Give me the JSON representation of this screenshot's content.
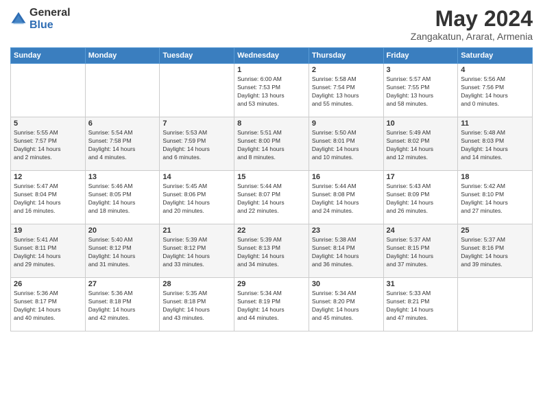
{
  "logo": {
    "general": "General",
    "blue": "Blue"
  },
  "header": {
    "month_year": "May 2024",
    "location": "Zangakatun, Ararat, Armenia"
  },
  "days_of_week": [
    "Sunday",
    "Monday",
    "Tuesday",
    "Wednesday",
    "Thursday",
    "Friday",
    "Saturday"
  ],
  "weeks": [
    [
      {
        "day": "",
        "info": ""
      },
      {
        "day": "",
        "info": ""
      },
      {
        "day": "",
        "info": ""
      },
      {
        "day": "1",
        "info": "Sunrise: 6:00 AM\nSunset: 7:53 PM\nDaylight: 13 hours\nand 53 minutes."
      },
      {
        "day": "2",
        "info": "Sunrise: 5:58 AM\nSunset: 7:54 PM\nDaylight: 13 hours\nand 55 minutes."
      },
      {
        "day": "3",
        "info": "Sunrise: 5:57 AM\nSunset: 7:55 PM\nDaylight: 13 hours\nand 58 minutes."
      },
      {
        "day": "4",
        "info": "Sunrise: 5:56 AM\nSunset: 7:56 PM\nDaylight: 14 hours\nand 0 minutes."
      }
    ],
    [
      {
        "day": "5",
        "info": "Sunrise: 5:55 AM\nSunset: 7:57 PM\nDaylight: 14 hours\nand 2 minutes."
      },
      {
        "day": "6",
        "info": "Sunrise: 5:54 AM\nSunset: 7:58 PM\nDaylight: 14 hours\nand 4 minutes."
      },
      {
        "day": "7",
        "info": "Sunrise: 5:53 AM\nSunset: 7:59 PM\nDaylight: 14 hours\nand 6 minutes."
      },
      {
        "day": "8",
        "info": "Sunrise: 5:51 AM\nSunset: 8:00 PM\nDaylight: 14 hours\nand 8 minutes."
      },
      {
        "day": "9",
        "info": "Sunrise: 5:50 AM\nSunset: 8:01 PM\nDaylight: 14 hours\nand 10 minutes."
      },
      {
        "day": "10",
        "info": "Sunrise: 5:49 AM\nSunset: 8:02 PM\nDaylight: 14 hours\nand 12 minutes."
      },
      {
        "day": "11",
        "info": "Sunrise: 5:48 AM\nSunset: 8:03 PM\nDaylight: 14 hours\nand 14 minutes."
      }
    ],
    [
      {
        "day": "12",
        "info": "Sunrise: 5:47 AM\nSunset: 8:04 PM\nDaylight: 14 hours\nand 16 minutes."
      },
      {
        "day": "13",
        "info": "Sunrise: 5:46 AM\nSunset: 8:05 PM\nDaylight: 14 hours\nand 18 minutes."
      },
      {
        "day": "14",
        "info": "Sunrise: 5:45 AM\nSunset: 8:06 PM\nDaylight: 14 hours\nand 20 minutes."
      },
      {
        "day": "15",
        "info": "Sunrise: 5:44 AM\nSunset: 8:07 PM\nDaylight: 14 hours\nand 22 minutes."
      },
      {
        "day": "16",
        "info": "Sunrise: 5:44 AM\nSunset: 8:08 PM\nDaylight: 14 hours\nand 24 minutes."
      },
      {
        "day": "17",
        "info": "Sunrise: 5:43 AM\nSunset: 8:09 PM\nDaylight: 14 hours\nand 26 minutes."
      },
      {
        "day": "18",
        "info": "Sunrise: 5:42 AM\nSunset: 8:10 PM\nDaylight: 14 hours\nand 27 minutes."
      }
    ],
    [
      {
        "day": "19",
        "info": "Sunrise: 5:41 AM\nSunset: 8:11 PM\nDaylight: 14 hours\nand 29 minutes."
      },
      {
        "day": "20",
        "info": "Sunrise: 5:40 AM\nSunset: 8:12 PM\nDaylight: 14 hours\nand 31 minutes."
      },
      {
        "day": "21",
        "info": "Sunrise: 5:39 AM\nSunset: 8:12 PM\nDaylight: 14 hours\nand 33 minutes."
      },
      {
        "day": "22",
        "info": "Sunrise: 5:39 AM\nSunset: 8:13 PM\nDaylight: 14 hours\nand 34 minutes."
      },
      {
        "day": "23",
        "info": "Sunrise: 5:38 AM\nSunset: 8:14 PM\nDaylight: 14 hours\nand 36 minutes."
      },
      {
        "day": "24",
        "info": "Sunrise: 5:37 AM\nSunset: 8:15 PM\nDaylight: 14 hours\nand 37 minutes."
      },
      {
        "day": "25",
        "info": "Sunrise: 5:37 AM\nSunset: 8:16 PM\nDaylight: 14 hours\nand 39 minutes."
      }
    ],
    [
      {
        "day": "26",
        "info": "Sunrise: 5:36 AM\nSunset: 8:17 PM\nDaylight: 14 hours\nand 40 minutes."
      },
      {
        "day": "27",
        "info": "Sunrise: 5:36 AM\nSunset: 8:18 PM\nDaylight: 14 hours\nand 42 minutes."
      },
      {
        "day": "28",
        "info": "Sunrise: 5:35 AM\nSunset: 8:18 PM\nDaylight: 14 hours\nand 43 minutes."
      },
      {
        "day": "29",
        "info": "Sunrise: 5:34 AM\nSunset: 8:19 PM\nDaylight: 14 hours\nand 44 minutes."
      },
      {
        "day": "30",
        "info": "Sunrise: 5:34 AM\nSunset: 8:20 PM\nDaylight: 14 hours\nand 45 minutes."
      },
      {
        "day": "31",
        "info": "Sunrise: 5:33 AM\nSunset: 8:21 PM\nDaylight: 14 hours\nand 47 minutes."
      },
      {
        "day": "",
        "info": ""
      }
    ]
  ]
}
